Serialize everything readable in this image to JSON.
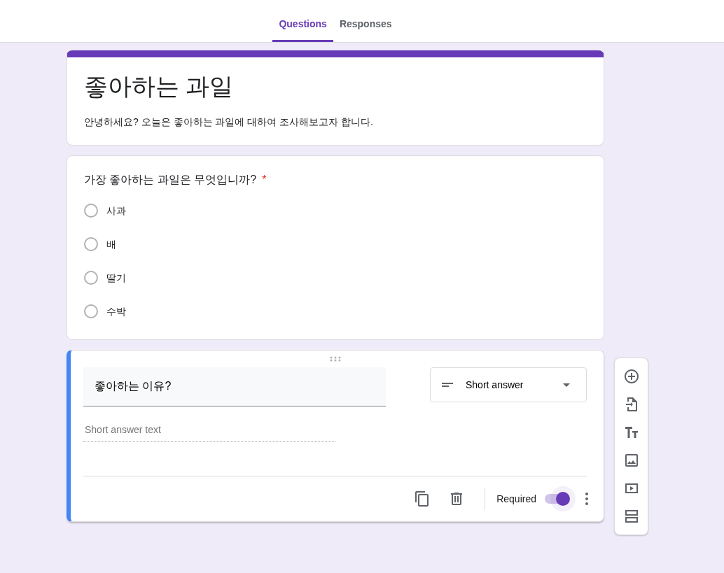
{
  "tabs": [
    {
      "label": "Questions",
      "selected": true
    },
    {
      "label": "Responses",
      "selected": false
    }
  ],
  "form": {
    "title": "좋아하는 과일",
    "description": "안녕하세요? 오늘은 좋아하는 과일에 대하여 조사해보고자 합니다."
  },
  "questions": [
    {
      "kind": "choice",
      "title": "가장 좋아하는 과일은 무엇입니까?",
      "required_mark": "*",
      "required": true,
      "active": false,
      "options": [
        {
          "label": "사과",
          "selected": false
        },
        {
          "label": "배",
          "selected": false
        },
        {
          "label": "딸기",
          "selected": false
        },
        {
          "label": "수박",
          "selected": false
        }
      ]
    },
    {
      "kind": "short",
      "title": "좋아하는 이유?",
      "type_label": "Short answer",
      "placeholder": "Short answer text",
      "required_label": "Required",
      "required": true,
      "active": true
    }
  ]
}
